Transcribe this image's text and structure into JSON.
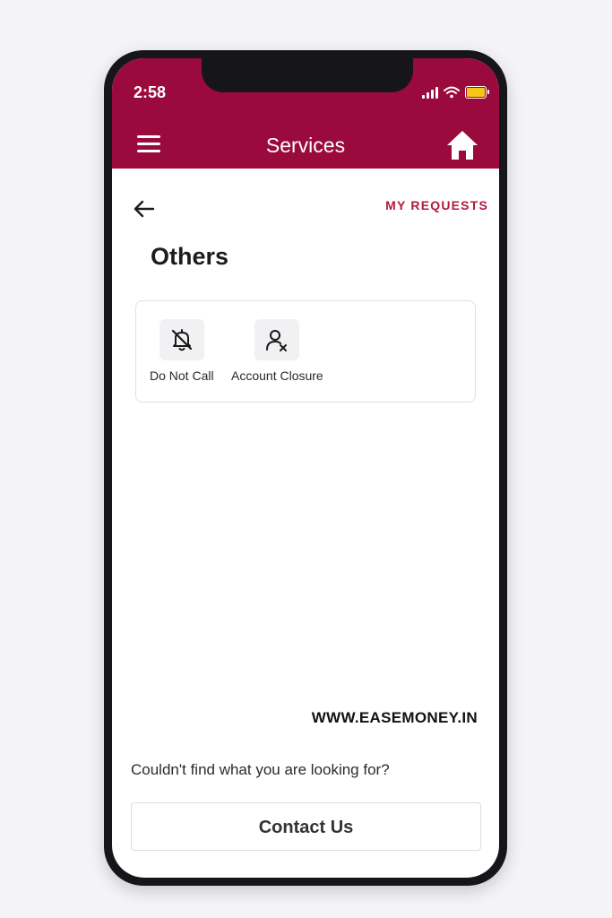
{
  "status_bar": {
    "time": "2:58",
    "battery_color": "#f5c518"
  },
  "header": {
    "title": "Services",
    "menu_icon": "hamburger-icon",
    "home_icon": "home-icon",
    "background_color": "#9b0a3c"
  },
  "page": {
    "back_icon": "arrow-left-icon",
    "my_requests_label": "MY REQUESTS",
    "section_title": "Others"
  },
  "services": [
    {
      "label": "Do Not Call",
      "icon": "bell-off-icon"
    },
    {
      "label": "Account Closure",
      "icon": "user-remove-icon"
    }
  ],
  "watermark": "WWW.EASEMONEY.IN",
  "footer": {
    "help_text": "Couldn't find what you are looking for?",
    "contact_label": "Contact Us"
  },
  "colors": {
    "accent": "#b11a3e"
  }
}
